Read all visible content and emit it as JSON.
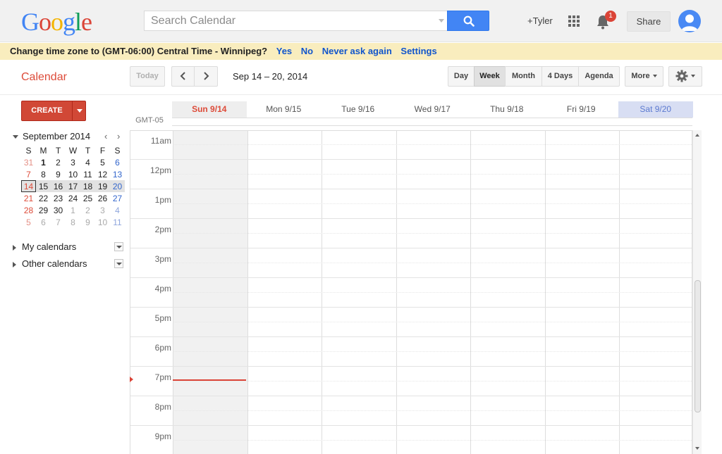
{
  "header": {
    "logo_letters": [
      {
        "ch": "G",
        "color": "#4285f4"
      },
      {
        "ch": "o",
        "color": "#db4437"
      },
      {
        "ch": "o",
        "color": "#f4b400"
      },
      {
        "ch": "g",
        "color": "#4285f4"
      },
      {
        "ch": "l",
        "color": "#0f9d58"
      },
      {
        "ch": "e",
        "color": "#db4437"
      }
    ],
    "search_placeholder": "Search Calendar",
    "search_icon": "search-icon",
    "user_link": "+Tyler",
    "apps_icon": "apps-grid-icon",
    "notifications_icon": "bell-icon",
    "notification_count": "1",
    "share_label": "Share",
    "avatar_icon": "user-avatar-icon"
  },
  "banner": {
    "message": "Change time zone to (GMT-06:00) Central Time - Winnipeg?",
    "links": [
      "Yes",
      "No",
      "Never ask again",
      "Settings"
    ]
  },
  "toolbar": {
    "app_title": "Calendar",
    "today_label": "Today",
    "prev_icon": "chevron-left-icon",
    "next_icon": "chevron-right-icon",
    "date_range": "Sep 14 – 20, 2014",
    "views": [
      "Day",
      "Week",
      "Month",
      "4 Days",
      "Agenda"
    ],
    "active_view": "Week",
    "more_label": "More",
    "settings_icon": "gear-icon"
  },
  "sidebar": {
    "create_label": "CREATE",
    "mini_calendar": {
      "month_label": "September 2014",
      "weekday_headers": [
        "S",
        "M",
        "T",
        "W",
        "T",
        "F",
        "S"
      ],
      "weeks": [
        [
          "31",
          "1",
          "2",
          "3",
          "4",
          "5",
          "6"
        ],
        [
          "7",
          "8",
          "9",
          "10",
          "11",
          "12",
          "13"
        ],
        [
          "14",
          "15",
          "16",
          "17",
          "18",
          "19",
          "20"
        ],
        [
          "21",
          "22",
          "23",
          "24",
          "25",
          "26",
          "27"
        ],
        [
          "28",
          "29",
          "30",
          "1",
          "2",
          "3",
          "4"
        ],
        [
          "5",
          "6",
          "7",
          "8",
          "9",
          "10",
          "11"
        ]
      ],
      "selected_week_index": 2,
      "today": "14"
    },
    "sections": [
      "My calendars",
      "Other calendars"
    ]
  },
  "week_view": {
    "timezone_label": "GMT-05",
    "days": [
      "Sun 9/14",
      "Mon 9/15",
      "Tue 9/16",
      "Wed 9/17",
      "Thu 9/18",
      "Fri 9/19",
      "Sat 9/20"
    ],
    "current_day": "Sun 9/14",
    "hours": [
      "11am",
      "12pm",
      "1pm",
      "2pm",
      "3pm",
      "4pm",
      "5pm",
      "6pm",
      "7pm",
      "8pm",
      "9pm"
    ],
    "now_time": "7pm"
  },
  "colors": {
    "accent_red": "#dd4b39",
    "search_blue": "#4285f4",
    "banner_yellow": "#f9edbe",
    "link_blue": "#1155cc",
    "saturday_bg": "#d8def3"
  }
}
